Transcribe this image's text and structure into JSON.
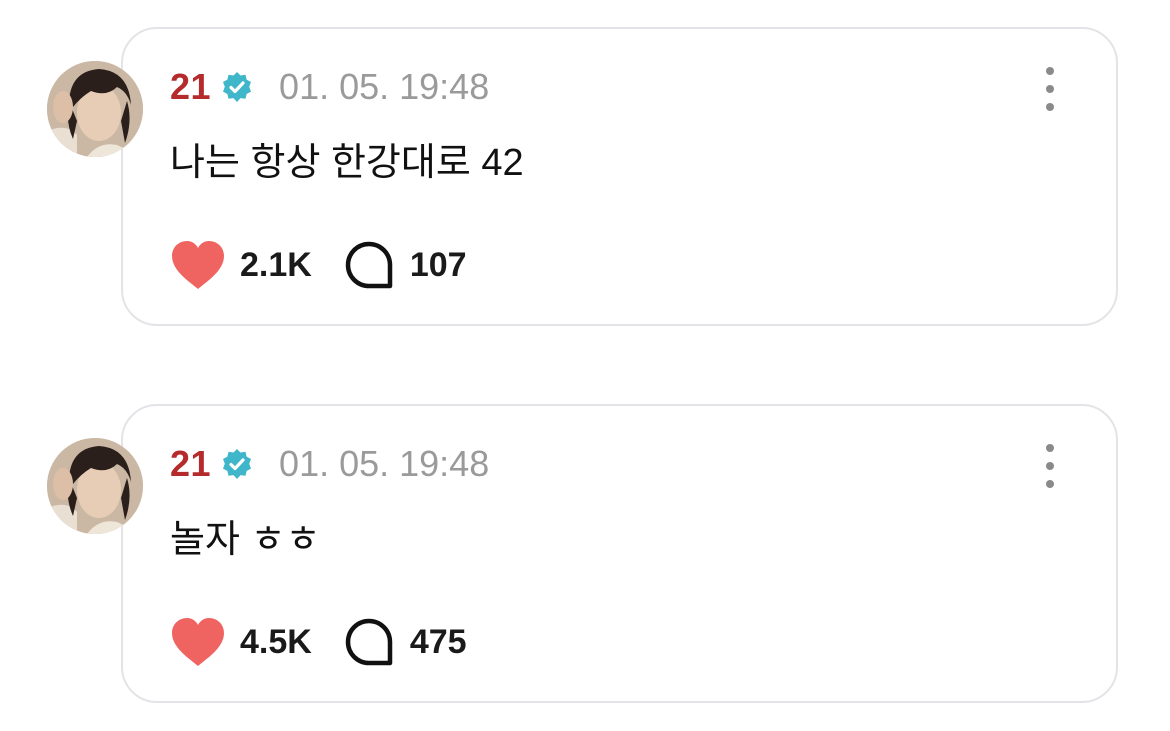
{
  "posts": [
    {
      "username": "21",
      "timestamp": "01. 05. 19:48",
      "text": "나는 항상 한강대로 42",
      "likes": "2.1K",
      "comments": "107"
    },
    {
      "username": "21",
      "timestamp": "01. 05. 19:48",
      "text": "놀자 ㅎㅎ",
      "likes": "4.5K",
      "comments": "475"
    }
  ],
  "icons": {
    "verified": "verified-badge-icon",
    "like": "heart-icon",
    "comment": "speech-bubble-icon",
    "more": "vertical-ellipsis-icon"
  },
  "colors": {
    "username": "#b52a2a",
    "verified": "#3fb6c9",
    "heart": "#ef6461",
    "timestamp": "#9a9a9a",
    "card_border": "#e4e4e8"
  }
}
